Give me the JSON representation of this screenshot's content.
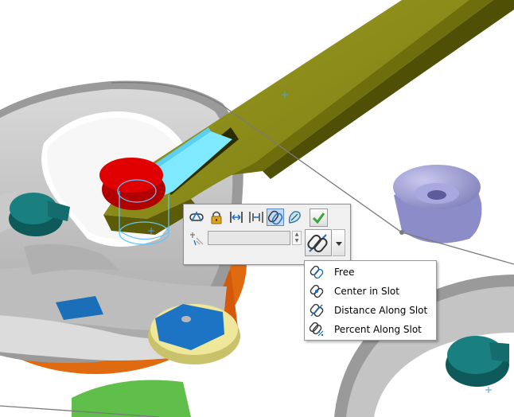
{
  "viewport": {
    "name": "3D model viewport"
  },
  "mate_toolbar": {
    "buttons": [
      {
        "name": "slot-mate",
        "icon": "slot-mate-icon"
      },
      {
        "name": "lock-mate",
        "icon": "lock-icon"
      },
      {
        "name": "distance-mate",
        "icon": "distance-icon"
      },
      {
        "name": "width-mate",
        "icon": "width-icon"
      },
      {
        "name": "slot-constraint",
        "icon": "slot-constraint-icon",
        "active": true
      },
      {
        "name": "profile-center",
        "icon": "profile-center-icon"
      }
    ],
    "ok_icon": "checkmark-icon",
    "value_field": {
      "value": "",
      "placeholder": ""
    },
    "mode_icon": "slot-chain-icon"
  },
  "dropdown": {
    "items": [
      {
        "label": "Free",
        "icon": "slot-free-icon"
      },
      {
        "label": "Center in Slot",
        "icon": "slot-center-icon"
      },
      {
        "label": "Distance Along Slot",
        "icon": "slot-distance-icon"
      },
      {
        "label": "Percent Along Slot",
        "icon": "slot-percent-icon"
      }
    ]
  },
  "colors": {
    "accent": "#5a8ac6",
    "ok_green": "#3aa33a",
    "slot_blue": "#6fe4ff",
    "arm_olive": "#8f8f1a"
  }
}
